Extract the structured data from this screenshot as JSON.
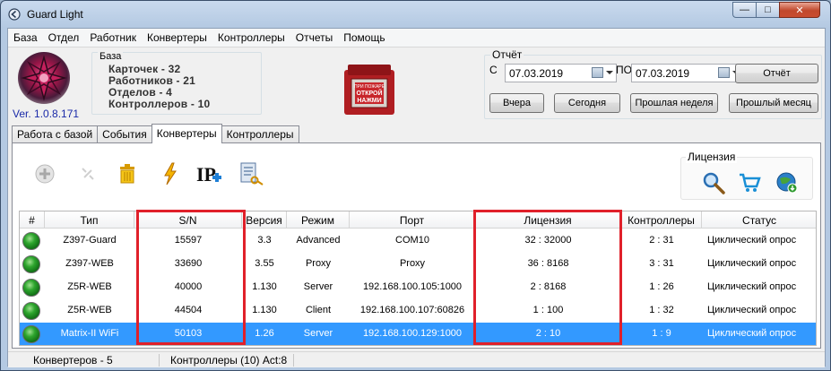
{
  "window": {
    "title": "Guard Light",
    "min_glyph": "—",
    "max_glyph": "□",
    "close_glyph": "✕"
  },
  "menu": [
    "База",
    "Отдел",
    "Работник",
    "Конвертеры",
    "Контроллеры",
    "Отчеты",
    "Помощь"
  ],
  "version": "Ver. 1.0.8.171",
  "db": {
    "legend": "База",
    "cards": "Карточек - 32",
    "employees": "Работников - 21",
    "departments": "Отделов - 4",
    "controllers": "Контроллеров - 10"
  },
  "alarm_lines": [
    "ПРИ ПОЖАРЕ",
    "ОТКРОЙ",
    "НАЖМИ"
  ],
  "report": {
    "legend": "Отчёт",
    "from_label": "С",
    "to_label": "ПО",
    "date_from": "07.03.2019",
    "date_to": "07.03.2019",
    "report_button": "Отчёт",
    "yesterday": "Вчера",
    "today": "Сегодня",
    "last_week": "Прошлая неделя",
    "last_month": "Прошлый месяц"
  },
  "tabs": [
    "Работа с базой",
    "События",
    "Конвертеры",
    "Контроллеры"
  ],
  "active_tab": "Конвертеры",
  "license_group": "Лицензия",
  "columns": [
    "#",
    "Тип",
    "S/N",
    "Версия",
    "Режим",
    "Порт",
    "Лицензия",
    "Контроллеры",
    "Статус"
  ],
  "rows": [
    {
      "type": "Z397-Guard",
      "sn": "15597",
      "version": "3.3",
      "mode": "Advanced",
      "port": "COM10",
      "license": "32 : 32000",
      "controllers": "2 : 31",
      "status": "Циклический опрос"
    },
    {
      "type": "Z397-WEB",
      "sn": "33690",
      "version": "3.55",
      "mode": "Proxy",
      "port": "Proxy",
      "license": "36 : 8168",
      "controllers": "3 : 31",
      "status": "Циклический опрос"
    },
    {
      "type": "Z5R-WEB",
      "sn": "40000",
      "version": "1.130",
      "mode": "Server",
      "port": "192.168.100.105:1000",
      "license": "2 : 8168",
      "controllers": "1 : 26",
      "status": "Циклический опрос"
    },
    {
      "type": "Z5R-WEB",
      "sn": "44504",
      "version": "1.130",
      "mode": "Client",
      "port": "192.168.100.107:60826",
      "license": "1 : 100",
      "controllers": "1 : 32",
      "status": "Циклический опрос"
    },
    {
      "type": "Matrix-II WiFi",
      "sn": "50103",
      "version": "1.26",
      "mode": "Server",
      "port": "192.168.100.129:1000",
      "license": "2 : 10",
      "controllers": "1 : 9",
      "status": "Циклический опрос"
    }
  ],
  "selected_row": 4,
  "status_bar": {
    "converters": "Конвертеров - 5",
    "controllers": "Контроллеры (10) Act:8"
  },
  "colors": {
    "selection": "#3399ff",
    "highlight_box": "#e0202a",
    "version_text": "#1a2aa8"
  }
}
